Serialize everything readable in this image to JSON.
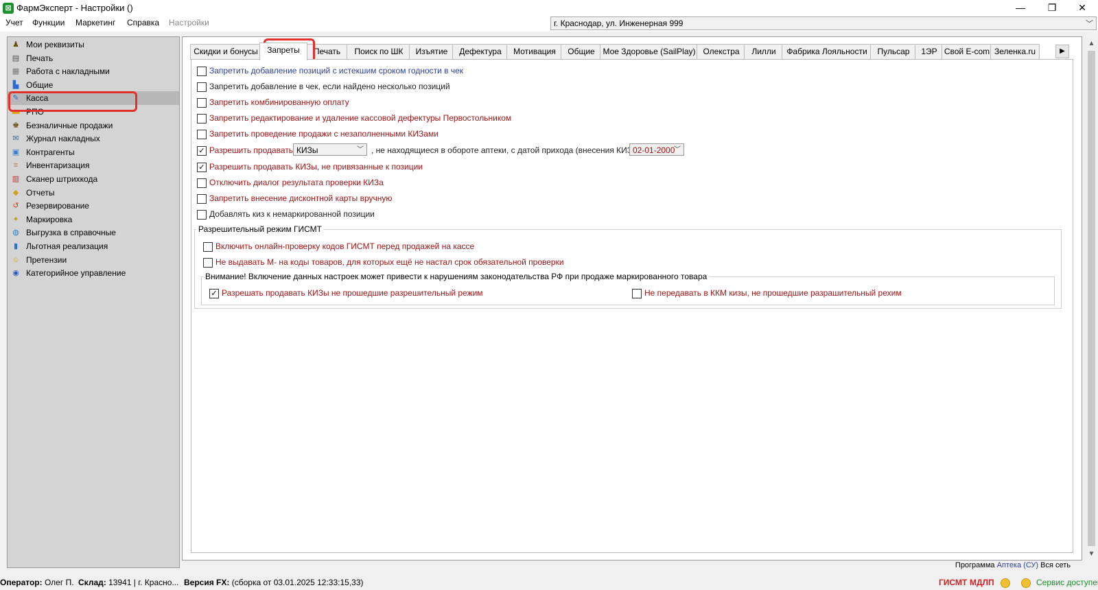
{
  "window": {
    "title": "ФармЭксперт - Настройки ()",
    "app_icon": "farmexpert-logo-icon",
    "controls": {
      "minimize": "—",
      "restore": "❐",
      "close": "✕"
    }
  },
  "menu": {
    "items": [
      "Учет",
      "Функции",
      "Маркетинг",
      "Справка",
      "Настройки"
    ]
  },
  "address": {
    "value": "г. Краснодар, ул. Инженерная 999"
  },
  "sidebar": {
    "items": [
      {
        "label": "Мои реквизиты",
        "icon": "requisites-icon",
        "selected": false
      },
      {
        "label": "Печать",
        "icon": "printer-icon",
        "selected": false
      },
      {
        "label": "Работа с накладными",
        "icon": "document-icon",
        "selected": false
      },
      {
        "label": "Общие",
        "icon": "general-icon",
        "selected": false
      },
      {
        "label": "Касса",
        "icon": "cash-register-icon",
        "selected": true
      },
      {
        "label": "РПО",
        "icon": "rpo-icon",
        "selected": false
      },
      {
        "label": "Безналичные продажи",
        "icon": "card-icon",
        "selected": false
      },
      {
        "label": "Журнал накладных",
        "icon": "journal-icon",
        "selected": false
      },
      {
        "label": "Контрагенты",
        "icon": "contacts-icon",
        "selected": false
      },
      {
        "label": "Инвентаризация",
        "icon": "inventory-icon",
        "selected": false
      },
      {
        "label": "Сканер штрихкода",
        "icon": "barcode-icon",
        "selected": false
      },
      {
        "label": "Отчеты",
        "icon": "reports-icon",
        "selected": false
      },
      {
        "label": "Резервирование",
        "icon": "reserve-icon",
        "selected": false
      },
      {
        "label": "Маркировка",
        "icon": "marking-icon",
        "selected": false
      },
      {
        "label": "Выгрузка в справочные",
        "icon": "globe-icon",
        "selected": false
      },
      {
        "label": "Льготная реализация",
        "icon": "benefit-icon",
        "selected": false
      },
      {
        "label": "Претензии",
        "icon": "claims-icon",
        "selected": false
      },
      {
        "label": "Категорийное управление",
        "icon": "category-icon",
        "selected": false
      }
    ]
  },
  "tabs": {
    "items": [
      "Скидки и бонусы",
      "Запреты",
      "Печать",
      "Поиск по ШК",
      "Изъятие",
      "Дефектура",
      "Мотивация",
      "Общие",
      "Мое Здоровье (SailPlay)",
      "Олекстра",
      "Лилли",
      "Фабрика Лояльности",
      "Пульсар",
      "1ЭР",
      "Свой E-com",
      "Зеленка.ru"
    ],
    "active": "Запреты",
    "scroll_arrow": "▶"
  },
  "options": {
    "o1": {
      "label": "Запретить добавление позиций с истекшим сроком годности в чек",
      "checked": false
    },
    "o2": {
      "label": "Запретить добавление в чек, если найдено несколько позиций",
      "checked": false
    },
    "o3": {
      "label": "Запретить комбинированную оплату",
      "checked": false
    },
    "o4": {
      "label": "Запретить редактирование и удаление кассовой дефектуры Первостольником",
      "checked": false
    },
    "o5": {
      "label": "Запретить проведение продажи с незаполненными КИЗами",
      "checked": false
    },
    "o6": {
      "label": "Разрешить продавать",
      "checked": true,
      "select_value": "КИЗы",
      "middle_text": ", не находящиеся в обороте аптеки, с датой прихода (внесения КИЗа) до",
      "date_value": "02-01-2000"
    },
    "o7": {
      "label": "Разрешить продавать КИЗы, не привязанные к позиции",
      "checked": true
    },
    "o8": {
      "label": "Отключить диалог результата проверки КИЗа",
      "checked": false
    },
    "o9": {
      "label": "Запретить внесение дисконтной карты вручную",
      "checked": false
    },
    "o10": {
      "label": "Добавлять киз к немаркированной позиции",
      "checked": false
    }
  },
  "gismt": {
    "title": "Разрешительный режим ГИСМТ",
    "g1": {
      "label": "Включить онлайн-проверку кодов ГИСМТ перед продажей на кассе",
      "checked": false
    },
    "g2": {
      "label": "Не выдавать М- на коды товаров, для которых ещё не настал срок обязательной проверки",
      "checked": false
    },
    "warning_title": "Внимание! Включение данных настроек может привести к нарушениям законодательства РФ при продаже маркированного товара",
    "w1": {
      "label": "Разрешать продавать КИЗы не прошедшие разрешительный режим",
      "checked": true
    },
    "w2": {
      "label": "Не передавать в ККМ кизы, не прошедшие разрашительный рехим",
      "checked": false
    }
  },
  "program_line": {
    "prefix": "Программа",
    "link": "Аптека (СУ)",
    "suffix": "Вся сеть"
  },
  "status": {
    "operator_label": "Оператор:",
    "operator_value": "Олег П.",
    "warehouse_label": "Склад:",
    "warehouse_value": "13941 | г. Красно...",
    "version_label": "Версия FX:",
    "version_value": "(сборка от 03.01.2025 12:33:15,33)",
    "gismt": "ГИСМТ",
    "mdlp": "МДЛП",
    "service": "Сервис доступен"
  },
  "colors": {
    "accent_red": "#e0302c",
    "option_blue": "#2c3fa0",
    "option_red": "#a01414",
    "status_green": "#1a8f2a"
  }
}
